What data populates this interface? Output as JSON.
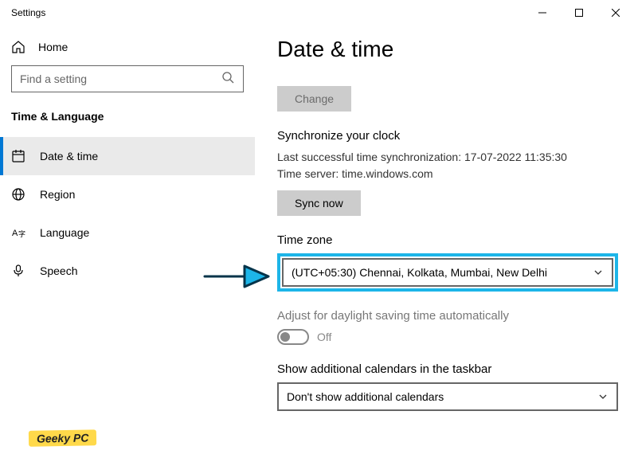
{
  "window": {
    "title": "Settings"
  },
  "sidebar": {
    "home_label": "Home",
    "search_placeholder": "Find a setting",
    "section_title": "Time & Language",
    "items": [
      {
        "label": "Date & time",
        "active": true
      },
      {
        "label": "Region"
      },
      {
        "label": "Language"
      },
      {
        "label": "Speech"
      }
    ]
  },
  "content": {
    "page_title": "Date & time",
    "change_button": "Change",
    "sync_heading": "Synchronize your clock",
    "last_sync_text": "Last successful time synchronization: 17-07-2022 11:35:30",
    "time_server_text": "Time server: time.windows.com",
    "sync_button": "Sync now",
    "timezone_heading": "Time zone",
    "timezone_value": "(UTC+05:30) Chennai, Kolkata, Mumbai, New Delhi",
    "dst_heading": "Adjust for daylight saving time automatically",
    "dst_state": "Off",
    "additional_cal_heading": "Show additional calendars in the taskbar",
    "additional_cal_value": "Don't show additional calendars"
  },
  "watermark": "Geeky PC"
}
